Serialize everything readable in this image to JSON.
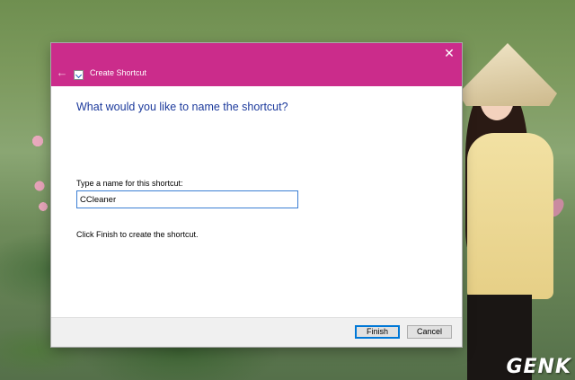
{
  "dialog": {
    "title": "Create Shortcut",
    "close_glyph": "✕",
    "back_glyph": "←",
    "heading": "What would you like to name the shortcut?",
    "field_label": "Type a name for this shortcut:",
    "field_value": "CCleaner",
    "hint": "Click Finish to create the shortcut.",
    "finish_label": "Finish",
    "cancel_label": "Cancel",
    "accent_color": "#cb2c8b"
  },
  "watermark": "GENK",
  "icons": [
    "back-arrow-icon",
    "shortcut-app-icon",
    "close-icon"
  ]
}
